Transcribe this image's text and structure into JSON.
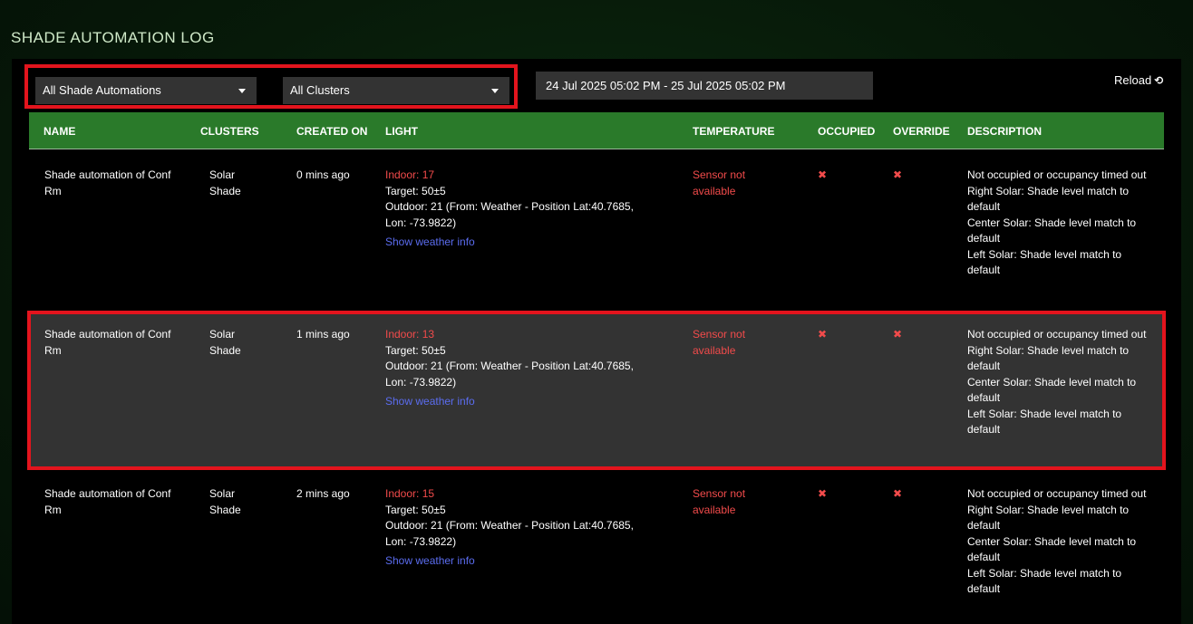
{
  "page_title": "SHADE AUTOMATION LOG",
  "filters": {
    "automation": "All Shade Automations",
    "cluster": "All Clusters",
    "date_range": "24 Jul 2025 05:02 PM - 25 Jul 2025 05:02 PM",
    "reload_label": "Reload"
  },
  "columns": {
    "name": "NAME",
    "clusters": "CLUSTERS",
    "created_on": "CREATED ON",
    "light": "LIGHT",
    "temperature": "TEMPERATURE",
    "occupied": "OCCUPIED",
    "override": "OVERRIDE",
    "description": "DESCRIPTION"
  },
  "rows": [
    {
      "name": "Shade automation of Conf Rm",
      "cluster": "Solar Shade",
      "created": "0 mins ago",
      "indoor": "Indoor: 17",
      "target": "Target: 50±5",
      "outdoor": "Outdoor: 21 (From: Weather - Position Lat:40.7685, Lon: -73.9822)",
      "weather_link": "Show weather info",
      "temperature": "Sensor not available",
      "occupied_icon": "✖",
      "override_icon": "✖",
      "desc": [
        "Not occupied or occupancy timed out",
        "Right Solar: Shade level match to default",
        "Center Solar: Shade level match to default",
        "Left Solar: Shade level match to default"
      ]
    },
    {
      "name": "Shade automation of Conf Rm",
      "cluster": "Solar Shade",
      "created": "1 mins ago",
      "indoor": "Indoor: 13",
      "target": "Target: 50±5",
      "outdoor": "Outdoor: 21 (From: Weather - Position Lat:40.7685, Lon: -73.9822)",
      "weather_link": "Show weather info",
      "temperature": "Sensor not available",
      "occupied_icon": "✖",
      "override_icon": "✖",
      "desc": [
        "Not occupied or occupancy timed out",
        "Right Solar: Shade level match to default",
        "Center Solar: Shade level match to default",
        "Left Solar: Shade level match to default"
      ]
    },
    {
      "name": "Shade automation of Conf Rm",
      "cluster": "Solar Shade",
      "created": "2 mins ago",
      "indoor": "Indoor: 15",
      "target": "Target: 50±5",
      "outdoor": "Outdoor: 21 (From: Weather - Position Lat:40.7685, Lon: -73.9822)",
      "weather_link": "Show weather info",
      "temperature": "Sensor not available",
      "occupied_icon": "✖",
      "override_icon": "✖",
      "desc": [
        "Not occupied or occupancy timed out",
        "Right Solar: Shade level match to default",
        "Center Solar: Shade level match to default",
        "Left Solar: Shade level match to default"
      ]
    }
  ]
}
